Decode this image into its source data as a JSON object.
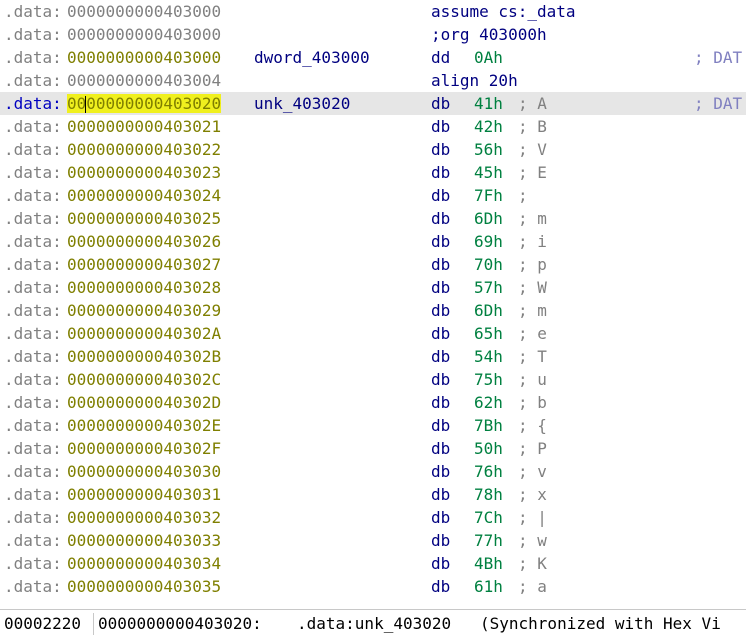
{
  "listing": [
    {
      "seg": ".data:",
      "addr": "0000000000403000",
      "name": "",
      "mn": "assume cs:_data",
      "op": "",
      "cm": "",
      "xref": ""
    },
    {
      "seg": ".data:",
      "addr": "0000000000403000",
      "name": "",
      "mn": ";org 403000h",
      "op": "",
      "cm": "",
      "xref": ""
    },
    {
      "seg": ".data:",
      "addr": "0000000000403000",
      "name": "dword_403000",
      "mn": "dd",
      "op": "0Ah",
      "cm": "",
      "xref": "; DAT"
    },
    {
      "seg": ".data:",
      "addr": "0000000000403004",
      "name": "",
      "mn": "align 20h",
      "op": "",
      "cm": "",
      "xref": ""
    },
    {
      "seg": ".data:",
      "addr": "0000000000403020",
      "name": "unk_403020",
      "mn": "db",
      "op": "41h",
      "cm": "; A",
      "xref": "; DAT",
      "selected": true
    },
    {
      "seg": ".data:",
      "addr": "0000000000403021",
      "name": "",
      "mn": "db",
      "op": "42h",
      "cm": "; B",
      "xref": ""
    },
    {
      "seg": ".data:",
      "addr": "0000000000403022",
      "name": "",
      "mn": "db",
      "op": "56h",
      "cm": "; V",
      "xref": ""
    },
    {
      "seg": ".data:",
      "addr": "0000000000403023",
      "name": "",
      "mn": "db",
      "op": "45h",
      "cm": "; E",
      "xref": ""
    },
    {
      "seg": ".data:",
      "addr": "0000000000403024",
      "name": "",
      "mn": "db",
      "op": "7Fh",
      "cm": ";",
      "xref": ""
    },
    {
      "seg": ".data:",
      "addr": "0000000000403025",
      "name": "",
      "mn": "db",
      "op": "6Dh",
      "cm": "; m",
      "xref": ""
    },
    {
      "seg": ".data:",
      "addr": "0000000000403026",
      "name": "",
      "mn": "db",
      "op": "69h",
      "cm": "; i",
      "xref": ""
    },
    {
      "seg": ".data:",
      "addr": "0000000000403027",
      "name": "",
      "mn": "db",
      "op": "70h",
      "cm": "; p",
      "xref": ""
    },
    {
      "seg": ".data:",
      "addr": "0000000000403028",
      "name": "",
      "mn": "db",
      "op": "57h",
      "cm": "; W",
      "xref": ""
    },
    {
      "seg": ".data:",
      "addr": "0000000000403029",
      "name": "",
      "mn": "db",
      "op": "6Dh",
      "cm": "; m",
      "xref": ""
    },
    {
      "seg": ".data:",
      "addr": "000000000040302A",
      "name": "",
      "mn": "db",
      "op": "65h",
      "cm": "; e",
      "xref": ""
    },
    {
      "seg": ".data:",
      "addr": "000000000040302B",
      "name": "",
      "mn": "db",
      "op": "54h",
      "cm": "; T",
      "xref": ""
    },
    {
      "seg": ".data:",
      "addr": "000000000040302C",
      "name": "",
      "mn": "db",
      "op": "75h",
      "cm": "; u",
      "xref": ""
    },
    {
      "seg": ".data:",
      "addr": "000000000040302D",
      "name": "",
      "mn": "db",
      "op": "62h",
      "cm": "; b",
      "xref": ""
    },
    {
      "seg": ".data:",
      "addr": "000000000040302E",
      "name": "",
      "mn": "db",
      "op": "7Bh",
      "cm": "; {",
      "xref": ""
    },
    {
      "seg": ".data:",
      "addr": "000000000040302F",
      "name": "",
      "mn": "db",
      "op": "50h",
      "cm": "; P",
      "xref": ""
    },
    {
      "seg": ".data:",
      "addr": "0000000000403030",
      "name": "",
      "mn": "db",
      "op": "76h",
      "cm": "; v",
      "xref": ""
    },
    {
      "seg": ".data:",
      "addr": "0000000000403031",
      "name": "",
      "mn": "db",
      "op": "78h",
      "cm": "; x",
      "xref": ""
    },
    {
      "seg": ".data:",
      "addr": "0000000000403032",
      "name": "",
      "mn": "db",
      "op": "7Ch",
      "cm": "; |",
      "xref": ""
    },
    {
      "seg": ".data:",
      "addr": "0000000000403033",
      "name": "",
      "mn": "db",
      "op": "77h",
      "cm": "; w",
      "xref": ""
    },
    {
      "seg": ".data:",
      "addr": "0000000000403034",
      "name": "",
      "mn": "db",
      "op": "4Bh",
      "cm": "; K",
      "xref": ""
    },
    {
      "seg": ".data:",
      "addr": "0000000000403035",
      "name": "",
      "mn": "db",
      "op": "61h",
      "cm": "; a",
      "xref": ""
    }
  ],
  "status": {
    "offset": "00002220",
    "address": "0000000000403020:",
    "label": ".data:unk_403020",
    "sync": "(Synchronized with Hex Vi"
  },
  "colors": {
    "segment": "#808080",
    "address": "#7f7f00",
    "mnemonic": "#000080",
    "operand": "#008040",
    "comment": "#808080",
    "xref": "#8080c0",
    "selection_row": "#e6e6e6",
    "address_highlight": "#f0f01e"
  }
}
